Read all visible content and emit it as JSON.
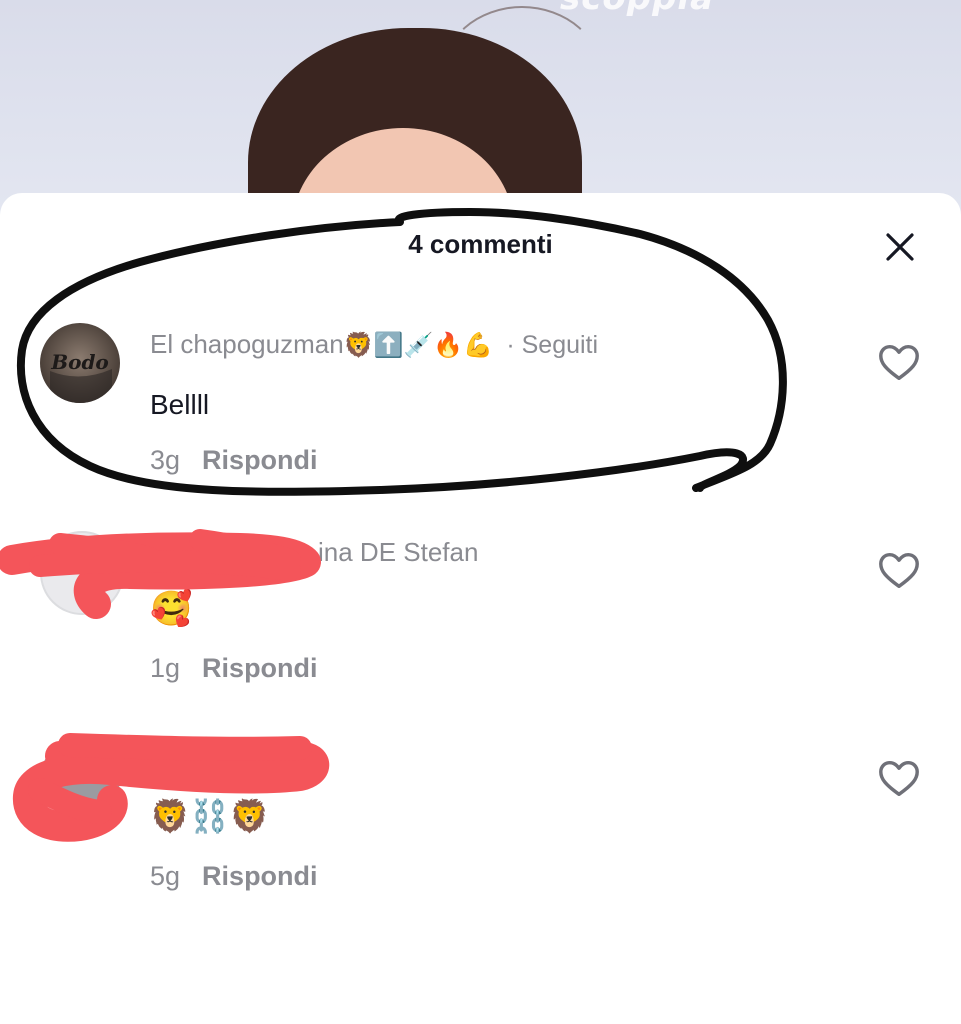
{
  "video": {
    "caption_partial": "scoppia"
  },
  "sheet": {
    "title": "4 commenti",
    "close_icon": "close-icon"
  },
  "comments": [
    {
      "username": "El chapoguzman",
      "username_emoji": "🦁⬆️💉🔥💪",
      "follow_status": "· Seguiti",
      "text": "Bellll",
      "age": "3g",
      "reply_label": "Rispondi",
      "avatar_text": "Bodo"
    },
    {
      "username": "Ch... ina DE Stefan",
      "username_visible": "ina DE Stefan",
      "text": "🥰",
      "age": "1g",
      "reply_label": "Rispondi"
    },
    {
      "username_visible": "",
      "text": "🦁⛓️🦁",
      "age": "5g",
      "reply_label": "Rispondi"
    }
  ],
  "colors": {
    "primary_text": "#161823",
    "secondary_text": "#8a8b91",
    "redaction": "#f4555a",
    "annotation": "#111111"
  }
}
